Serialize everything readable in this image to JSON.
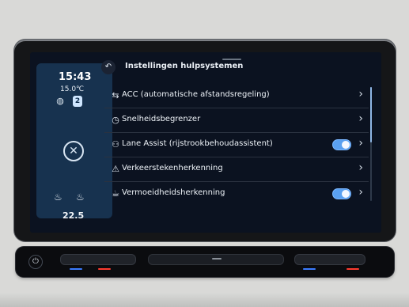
{
  "status": {
    "time": "15:43",
    "outside_temp": "15.0℃",
    "badge": "2",
    "inside_temp": "22.5",
    "icons": [
      "globe-icon",
      "close-icon",
      "seat-heat-icon",
      "seat-heat-icon"
    ]
  },
  "header": {
    "back_icon": "back-arrow-icon",
    "title": "Instellingen hulpsystemen"
  },
  "list": {
    "items": [
      {
        "label": "ACC (automatische afstandsregeling)",
        "icon": "acc-icon",
        "toggle": false
      },
      {
        "label": "Snelheidsbegrenzer",
        "icon": "speed-limiter-icon",
        "toggle": false
      },
      {
        "label": "Lane Assist (rijstrookbehoudassistent)",
        "icon": "lane-assist-icon",
        "toggle": true
      },
      {
        "label": "Verkeerstekenherkenning",
        "icon": "traffic-sign-icon",
        "toggle": false
      },
      {
        "label": "Vermoeidheidsherkenning",
        "icon": "fatigue-icon",
        "toggle": true
      }
    ]
  },
  "colors": {
    "accent": "#5aa0f0",
    "left_panel": "#17324f",
    "screen_bg": "#0b1220"
  }
}
